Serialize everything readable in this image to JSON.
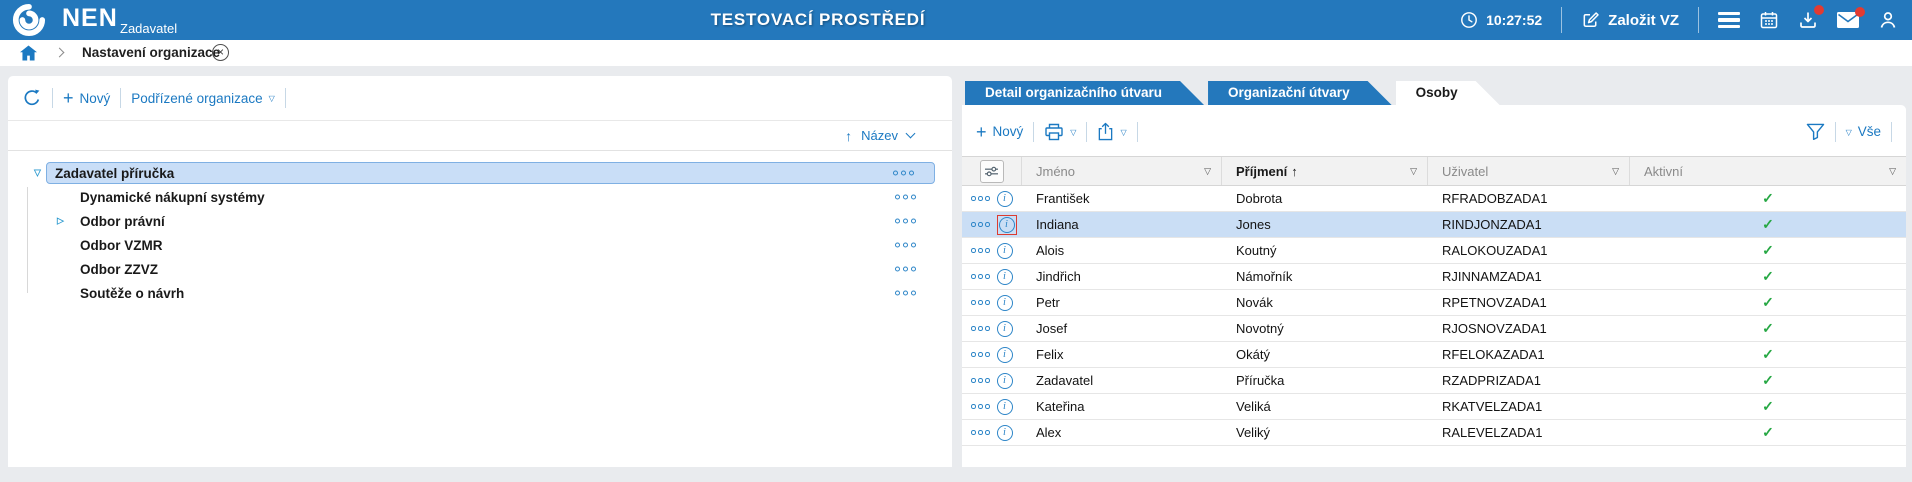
{
  "header": {
    "logo_text": "NEN",
    "logo_subtitle": "Zadavatel",
    "environment_title": "TESTOVACÍ PROSTŘEDÍ",
    "time": "10:27:52",
    "create_vz_label": "Založit VZ"
  },
  "breadcrumb": {
    "title": "Nastavení organizace"
  },
  "icons": {
    "plus": "+",
    "dropdown_triangle": "▽",
    "filter_triangle": "▽",
    "sort_arrow": "↑",
    "close": "×",
    "expander_expanded": "▽",
    "expander_collapsed": "▷",
    "info": "i"
  },
  "left_panel": {
    "toolbar": {
      "new_label": "Nový",
      "org_dropdown_label": "Podřízené organizace"
    },
    "sort": {
      "label": "Název"
    },
    "tree": [
      {
        "label": "Zadavatel příručka",
        "level": 0,
        "expander": "expanded",
        "selected": true
      },
      {
        "label": "Dynamické nákupní systémy",
        "level": 1,
        "expander": "none",
        "selected": false
      },
      {
        "label": "Odbor právní",
        "level": 1,
        "expander": "collapsed",
        "selected": false
      },
      {
        "label": "Odbor VZMR",
        "level": 1,
        "expander": "none",
        "selected": false
      },
      {
        "label": "Odbor ZZVZ",
        "level": 1,
        "expander": "none",
        "selected": false
      },
      {
        "label": "Soutěže o návrh",
        "level": 1,
        "expander": "none",
        "selected": false
      }
    ]
  },
  "right_panel": {
    "tabs": [
      {
        "label": "Detail organizačního útvaru",
        "active": false
      },
      {
        "label": "Organizační útvary",
        "active": false
      },
      {
        "label": "Osoby",
        "active": true
      }
    ],
    "toolbar": {
      "new_label": "Nový",
      "all_label": "Vše"
    },
    "table": {
      "headers": {
        "jmeno": "Jméno",
        "prijmeni": "Příjmení",
        "uzivatel": "Uživatel",
        "aktivni": "Aktivní"
      },
      "sort_column": "Příjmení",
      "sort_direction": "asc",
      "selected_row_index": 1,
      "rows": [
        {
          "jmeno": "František",
          "prijmeni": "Dobrota",
          "uzivatel": "RFRADOBZADA1",
          "aktivni": "✓"
        },
        {
          "jmeno": "Indiana",
          "prijmeni": "Jones",
          "uzivatel": "RINDJONZADA1",
          "aktivni": "✓"
        },
        {
          "jmeno": "Alois",
          "prijmeni": "Koutný",
          "uzivatel": "RALOKOUZADA1",
          "aktivni": "✓"
        },
        {
          "jmeno": "Jindřich",
          "prijmeni": "Námořník",
          "uzivatel": "RJINNAMZADA1",
          "aktivni": "✓"
        },
        {
          "jmeno": "Petr",
          "prijmeni": "Novák",
          "uzivatel": "RPETNOVZADA1",
          "aktivni": "✓"
        },
        {
          "jmeno": "Josef",
          "prijmeni": "Novotný",
          "uzivatel": "RJOSNOVZADA1",
          "aktivni": "✓"
        },
        {
          "jmeno": "Felix",
          "prijmeni": "Okátý",
          "uzivatel": "RFELOKAZADA1",
          "aktivni": "✓"
        },
        {
          "jmeno": "Zadavatel",
          "prijmeni": "Příručka",
          "uzivatel": "RZADPRIZADA1",
          "aktivni": "✓"
        },
        {
          "jmeno": "Kateřina",
          "prijmeni": "Veliká",
          "uzivatel": "RKATVELZADA1",
          "aktivni": "✓"
        },
        {
          "jmeno": "Alex",
          "prijmeni": "Veliký",
          "uzivatel": "RALEVELZADA1",
          "aktivni": "✓"
        }
      ]
    }
  },
  "colors": {
    "header_blue": "#2478bc",
    "accent_blue": "#1b79c2",
    "selected_table_row": "#cadef5",
    "selected_tree_row": "#c9def7",
    "active_green": "#27a844",
    "alert_red": "#e23b32"
  }
}
